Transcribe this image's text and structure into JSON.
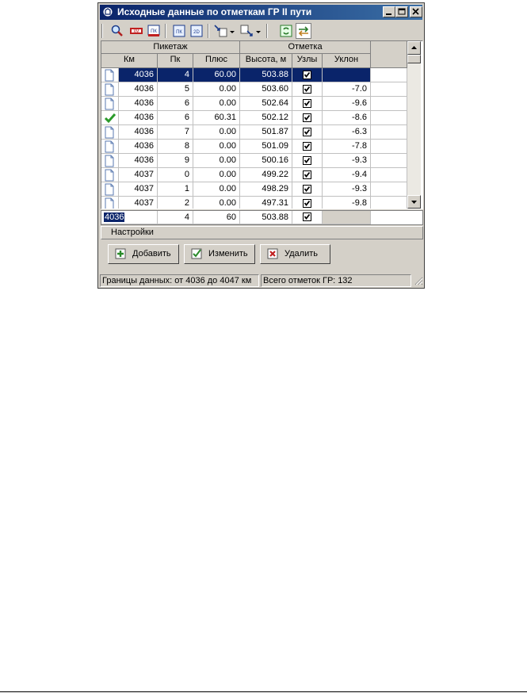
{
  "window": {
    "title": "Исходные данные по отметкам ГР II пути",
    "controls": {
      "minimize": "minimize-icon",
      "maximize": "maximize-icon",
      "close": "close-icon"
    }
  },
  "toolbar": {
    "buttons": [
      "search-icon",
      "km-ruler-icon",
      "pk-ruler-icon",
      "pk-icon",
      "2d-icon",
      "import-icon",
      "export-icon",
      "refresh-icon",
      "sync-icon"
    ]
  },
  "grid": {
    "group_headers": {
      "piketazh": "Пикетаж",
      "otmetka": "Отметка"
    },
    "columns": {
      "km": "Км",
      "pk": "Пк",
      "plus": "Плюс",
      "height": "Высота, м",
      "nodes": "Узлы",
      "slope": "Уклон"
    },
    "rows": [
      {
        "icon": "document-icon",
        "km": "4036",
        "pk": "4",
        "plus": "60.00",
        "height": "503.88",
        "node": true,
        "slope": "",
        "selected": true
      },
      {
        "icon": "document-icon",
        "km": "4036",
        "pk": "5",
        "plus": "0.00",
        "height": "503.60",
        "node": true,
        "slope": "-7.0"
      },
      {
        "icon": "document-icon",
        "km": "4036",
        "pk": "6",
        "plus": "0.00",
        "height": "502.64",
        "node": true,
        "slope": "-9.6"
      },
      {
        "icon": "checkmark-icon",
        "km": "4036",
        "pk": "6",
        "plus": "60.31",
        "height": "502.12",
        "node": true,
        "slope": "-8.6"
      },
      {
        "icon": "document-icon",
        "km": "4036",
        "pk": "7",
        "plus": "0.00",
        "height": "501.87",
        "node": true,
        "slope": "-6.3"
      },
      {
        "icon": "document-icon",
        "km": "4036",
        "pk": "8",
        "plus": "0.00",
        "height": "501.09",
        "node": true,
        "slope": "-7.8"
      },
      {
        "icon": "document-icon",
        "km": "4036",
        "pk": "9",
        "plus": "0.00",
        "height": "500.16",
        "node": true,
        "slope": "-9.3"
      },
      {
        "icon": "document-icon",
        "km": "4037",
        "pk": "0",
        "plus": "0.00",
        "height": "499.22",
        "node": true,
        "slope": "-9.4"
      },
      {
        "icon": "document-icon",
        "km": "4037",
        "pk": "1",
        "plus": "0.00",
        "height": "498.29",
        "node": true,
        "slope": "-9.3"
      },
      {
        "icon": "document-icon",
        "km": "4037",
        "pk": "2",
        "plus": "0.00",
        "height": "497.31",
        "node": true,
        "slope": "-9.8"
      }
    ]
  },
  "editor": {
    "km": "4036",
    "pk": "4",
    "plus": "60",
    "height": "503.88",
    "node": true
  },
  "settings_label": "Настройки",
  "buttons": {
    "add": "Добавить",
    "edit": "Изменить",
    "delete": "Удалить"
  },
  "status": {
    "range": "Границы данных: от 4036 до 4047 км",
    "total": "Всего отметок ГР: 132"
  },
  "colors": {
    "title_start": "#0a246a",
    "title_end": "#3a6ea5",
    "selection": "#0a246a",
    "face": "#d4d0c8"
  }
}
